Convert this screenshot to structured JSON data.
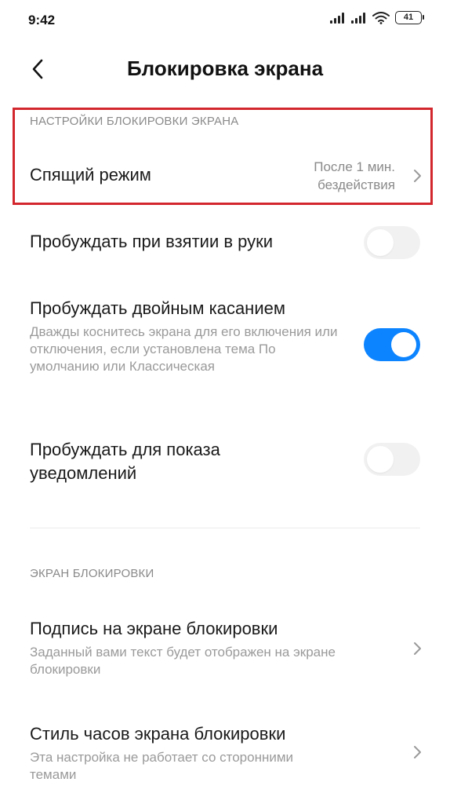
{
  "status_bar": {
    "time": "9:42",
    "battery": "41"
  },
  "header": {
    "title": "Блокировка экрана"
  },
  "section_lock_settings": {
    "header": "НАСТРОЙКИ БЛОКИРОВКИ ЭКРАНА",
    "sleep": {
      "title": "Спящий режим",
      "value_line1": "После 1 мин.",
      "value_line2": "бездействия"
    },
    "wake_pickup": {
      "title": "Пробуждать при взятии в руки",
      "enabled": false
    },
    "wake_double_tap": {
      "title": "Пробуждать двойным касанием",
      "description": "Дважды коснитесь экрана для его включения или отключения, если установлена тема По умолчанию или Классическая",
      "enabled": true
    },
    "wake_notifications": {
      "title": "Пробуждать для показа уведомлений",
      "enabled": false
    }
  },
  "section_lock_screen": {
    "header": "ЭКРАН БЛОКИРОВКИ",
    "signature": {
      "title": "Подпись на экране блокировки",
      "description": "Заданный вами текст будет отображен на экране блокировки"
    },
    "clock_style": {
      "title": "Стиль часов экрана блокировки",
      "description": "Эта настройка не работает со сторонними темами"
    }
  },
  "colors": {
    "accent": "#0d84ff",
    "highlight": "#d3272e",
    "secondary_text": "#8a8a8a"
  }
}
